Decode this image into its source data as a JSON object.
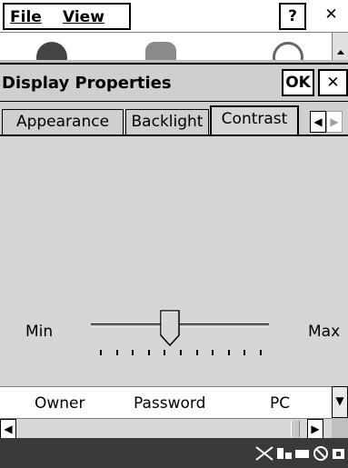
{
  "menubar": {
    "file_label": "File",
    "view_label": "View",
    "help_label": "?",
    "close_label": "✕"
  },
  "dialog": {
    "title": "Display Properties",
    "ok_label": "OK",
    "close_label": "✕",
    "tabs": [
      {
        "label": "Appearance",
        "active": false
      },
      {
        "label": "Backlight",
        "active": false
      },
      {
        "label": "Contrast",
        "active": true
      }
    ],
    "tab_scroll_left": "◀",
    "tab_scroll_right": "▶",
    "contrast": {
      "min_label": "Min",
      "max_label": "Max",
      "slider_value_fraction": 0.44,
      "tick_count": 11
    }
  },
  "list": {
    "columns": [
      "Owner",
      "Password",
      "PC"
    ],
    "scroll_down": "▼"
  },
  "hscroll": {
    "left_arrow": "◀",
    "right_arrow": "▶"
  },
  "icons": [
    "bluetooth-icon",
    "gear-icon",
    "clock-icon",
    "no-connection-icon",
    "input-panel-icon",
    "battery-icon",
    "no-sound-icon",
    "power-icon"
  ],
  "colors": {
    "dialog_bg": "#cfcfcf",
    "panel_bg": "#d6d6d6",
    "taskbar_bg": "#3a3a3a"
  }
}
